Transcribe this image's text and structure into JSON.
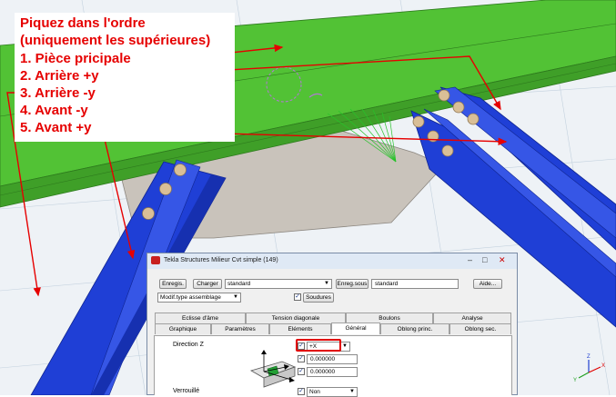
{
  "annotation": {
    "lines": [
      "Piquez dans l'ordre",
      "(uniquement les supérieures)",
      "1. Pièce pricipale",
      "2. Arrière +y",
      "3. Arrière -y",
      "4.  Avant -y",
      "5. Avant +y"
    ],
    "color": "#e60000"
  },
  "dialog": {
    "title": "Tekla Structures  Milieur Cvt simple (149)",
    "window_buttons": [
      "–",
      "□",
      "✕"
    ],
    "toolbar": {
      "save_label": "Enregis.",
      "load_label": "Charger",
      "preset_value": "standard",
      "save_as_label": "Enreg.sous",
      "save_as_value": "standard",
      "help_label": "Aide...",
      "assembly_mode_value": "Modif.type assemblage",
      "welds_checked": true,
      "welds_label": "Soudures"
    },
    "tabs_row1": [
      "Eclisse d'âme",
      "Tension diagonale",
      "Boulons",
      "Analyse"
    ],
    "tabs_row2": [
      "Graphique",
      "Paramètres",
      "Eléments",
      "Général",
      "Oblong princ.",
      "Oblong sec."
    ],
    "active_tab": "Général",
    "general": {
      "direction_z_label": "Direction Z",
      "direction_z_value": "+X",
      "offset_1": "0.000000",
      "offset_2": "0.000000",
      "next_label": "Verrouillé",
      "next_value": "Non"
    }
  },
  "axis_indicator": {
    "z": "Z",
    "x": "X",
    "y": "Y"
  },
  "colors": {
    "beam_green": "#52c235",
    "beam_blue": "#1f3fd6",
    "gusset_plate": "#c9c3bb",
    "background": "#eef2f6",
    "dialog_highlight": "#e00000"
  }
}
